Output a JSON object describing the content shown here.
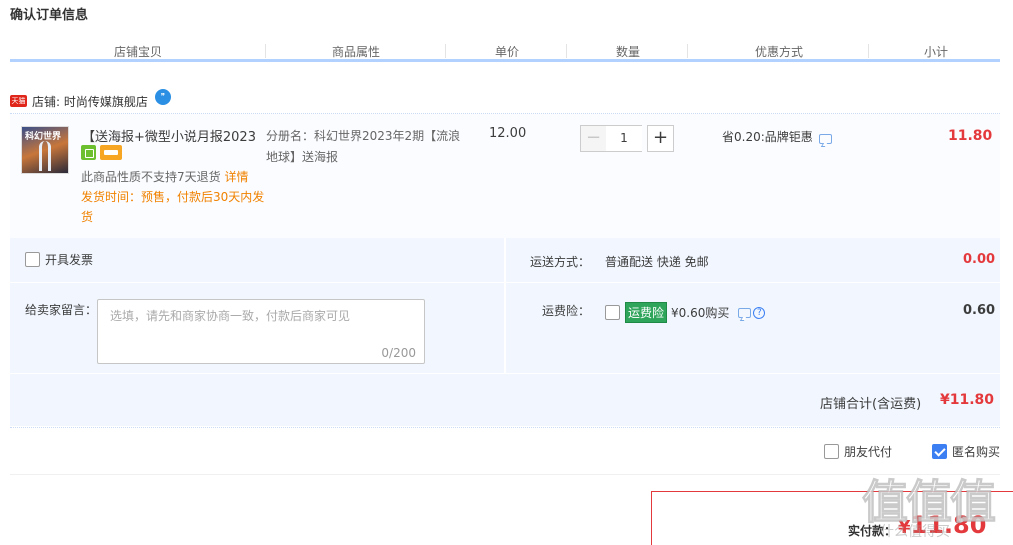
{
  "page_title": "确认订单信息",
  "columns": [
    "店铺宝贝",
    "商品属性",
    "单价",
    "数量",
    "优惠方式",
    "小计"
  ],
  "shop": {
    "badge": "天猫",
    "label": "店铺: 时尚传媒旗舰店",
    "wangwang_icon": "wangwang-chat-icon"
  },
  "item": {
    "name": "【送海报+微型小说月报2023...",
    "no_return": "此商品性质不支持7天退货",
    "detail_link": "详情",
    "ship_time": "发货时间：预售，付款后30天内发货",
    "property": "分册名：科幻世界2023年2期【流浪地球】送海报",
    "price": "12.00",
    "quantity": "1",
    "minus": "−",
    "plus": "+",
    "discount": "省0.20:品牌钜惠",
    "subtotal": "11.80"
  },
  "invoice": {
    "label": "开具发票"
  },
  "message": {
    "label": "给卖家留言：",
    "placeholder": "选填，请先和商家协商一致，付款后商家可见",
    "counter": "0/200"
  },
  "shipping": {
    "label": "运送方式：",
    "value": "普通配送 快递 免邮",
    "price": "0.00"
  },
  "insurance": {
    "label": "运费险：",
    "tag": "运费险",
    "value": "¥0.60购买",
    "price": "0.60"
  },
  "shop_total": {
    "label": "店铺合计(含运费)",
    "value": "¥11.80"
  },
  "options": {
    "friend_pay": "朋友代付",
    "anonymous": "匿名购买"
  },
  "pay": {
    "label": "实付款：",
    "currency": "¥",
    "value": "11.80"
  },
  "watermark": {
    "logo": "值值值",
    "site": "什么值得买"
  },
  "colors": {
    "accent": "#e4393c",
    "header_line": "#b2d1ff",
    "panel_bg": "#f2f7ff",
    "check_on": "#3b7ff3"
  }
}
